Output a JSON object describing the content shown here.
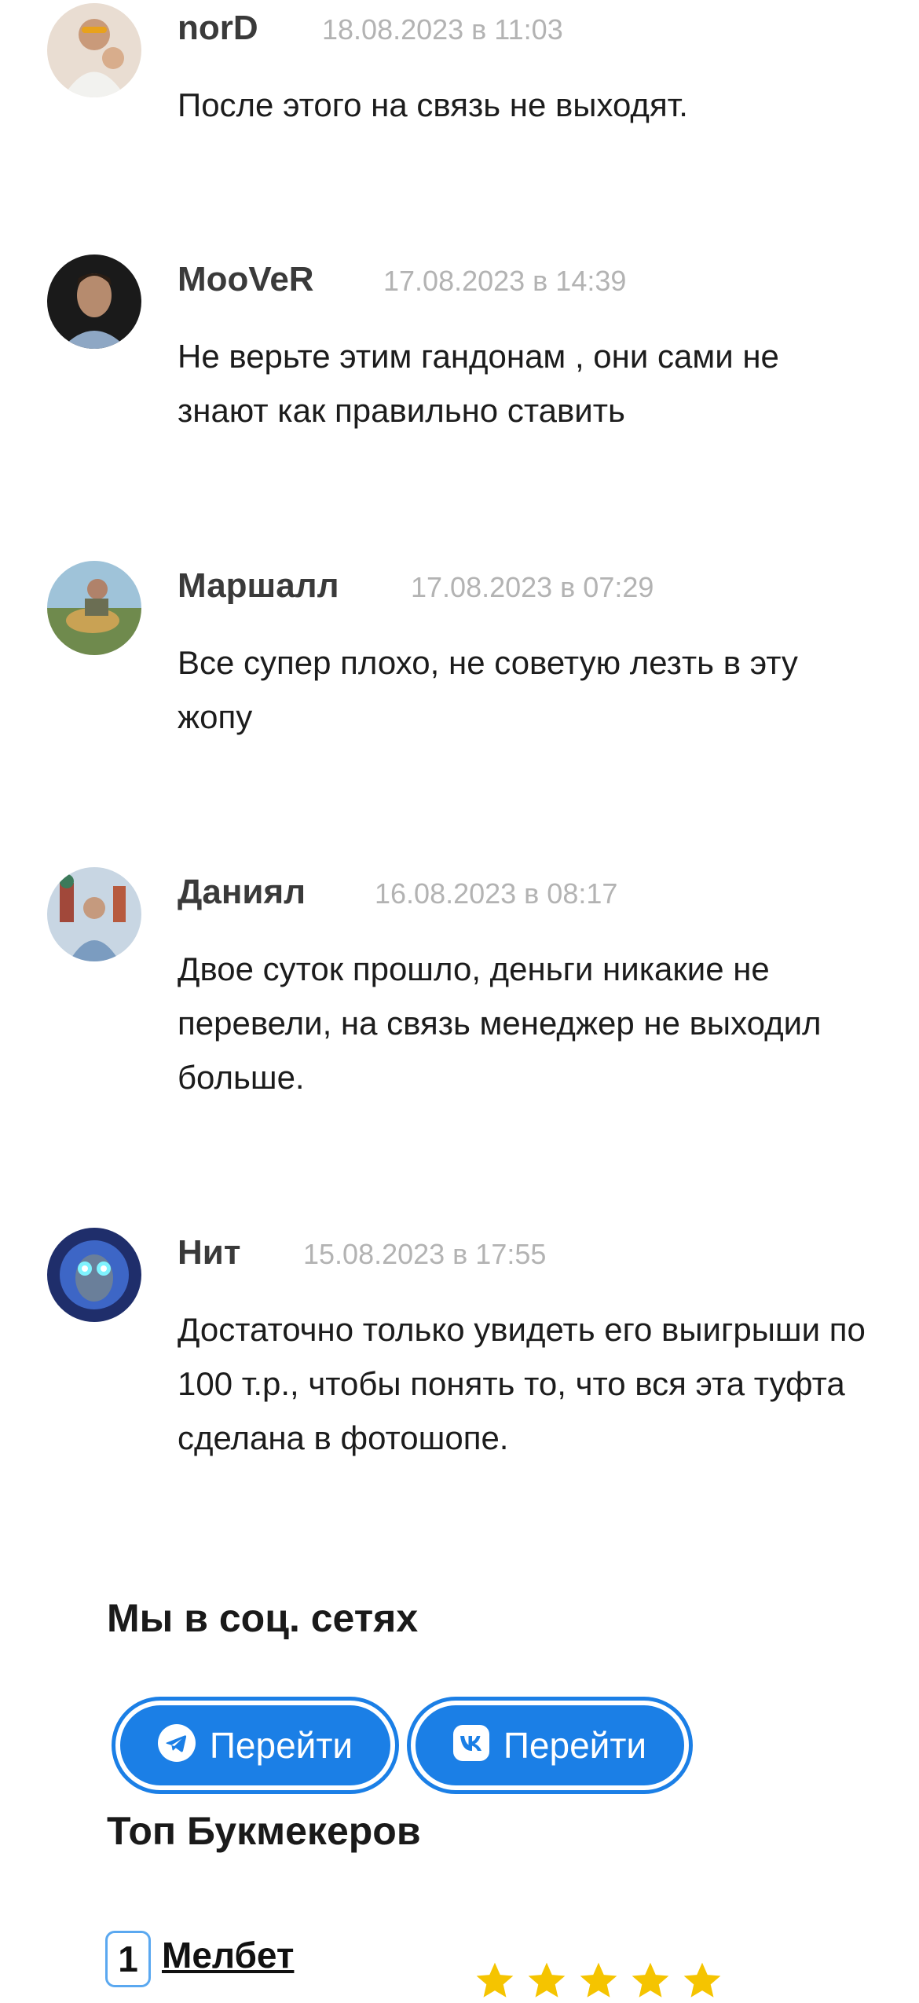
{
  "comments": [
    {
      "author": "norD",
      "date": "18.08.2023 в 11:03",
      "text": "После этого на связь не выходят."
    },
    {
      "author": "MooVeR",
      "date": "17.08.2023 в 14:39",
      "text": "Не верьте этим гандонам , они сами не знают как правильно ставить"
    },
    {
      "author": "Маршалл",
      "date": "17.08.2023 в 07:29",
      "text": "Все супер плохо, не советую лезть в эту жопу"
    },
    {
      "author": "Даниял",
      "date": "16.08.2023 в 08:17",
      "text": "Двое суток прошло, деньги никакие не перевели, на связь менеджер не выходил больше."
    },
    {
      "author": "Нит",
      "date": "15.08.2023 в 17:55",
      "text": "Достаточно только увидеть его выигрыши по 100 т.р., чтобы понять то, что вся эта туфта сделана в фотошопе."
    }
  ],
  "social": {
    "title": "Мы в соц. сетях",
    "buttons": [
      {
        "network": "telegram",
        "icon": "telegram-icon",
        "label": "Перейти"
      },
      {
        "network": "vk",
        "icon": "vk-icon",
        "label": "Перейти"
      }
    ]
  },
  "bookmakers": {
    "title": "Топ Букмекеров",
    "items": [
      {
        "rank": "1",
        "name": "Мелбет",
        "stars": 5
      }
    ]
  },
  "colors": {
    "accent": "#1b7fe6",
    "date_gray": "#b3b3b3",
    "star": "#f5c400"
  }
}
